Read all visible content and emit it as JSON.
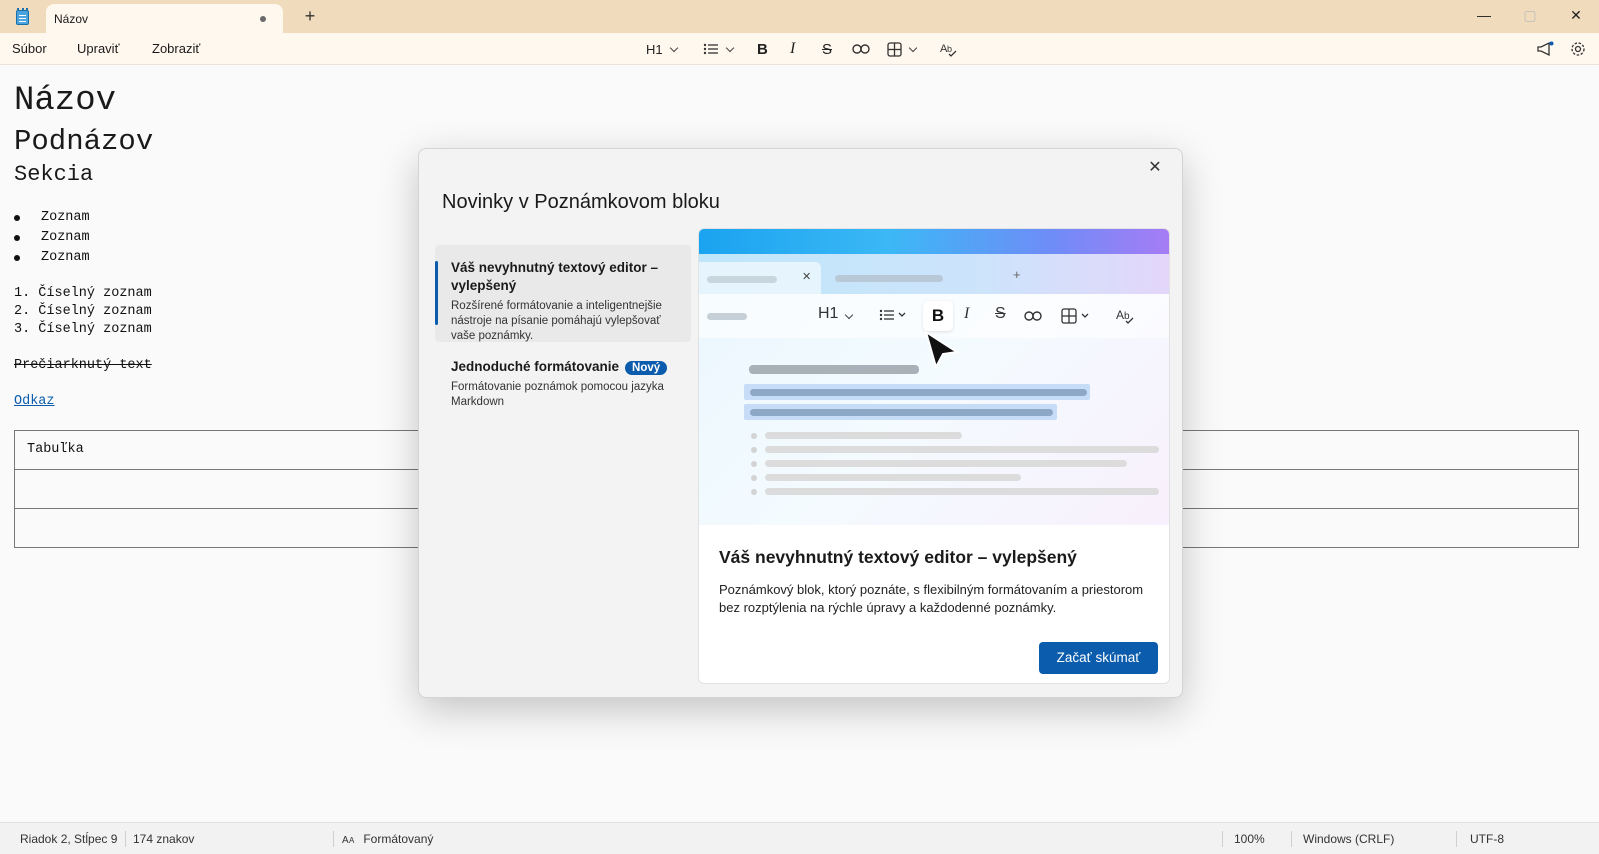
{
  "window": {
    "tab_title": "Názov",
    "new_tab_symbol": "+",
    "minimize_symbol": "—",
    "maximize_symbol": "▢",
    "close_symbol": "✕"
  },
  "menu": {
    "file": "Súbor",
    "edit": "Upraviť",
    "view": "Zobraziť"
  },
  "toolbar": {
    "heading": "H1",
    "bold": "B",
    "italic": "I",
    "strikethrough": "S"
  },
  "document": {
    "title": "Názov",
    "subtitle": "Podnázov",
    "section": "Sekcia",
    "bullets": [
      "Zoznam",
      "Zoznam",
      "Zoznam"
    ],
    "numbered": [
      "1. Číselný zoznam",
      "2. Číselný zoznam",
      "3. Číselný zoznam"
    ],
    "strikethrough_text": "Prečiarknutý text",
    "link_text": "Odkaz",
    "table_header": "Tabuľka"
  },
  "status": {
    "position": "Riadok 2, Stĺpec 9",
    "chars": "174 znakov",
    "mode": "Formátovaný",
    "zoom": "100%",
    "line_endings": "Windows (CRLF)",
    "encoding": "UTF-8"
  },
  "dialog": {
    "title": "Novinky v Poznámkovom bloku",
    "close_symbol": "✕",
    "nav": [
      {
        "heading": "Váš nevyhnutný textový editor – vylepšený",
        "desc": "Rozšírené formátovanie a inteligentnejšie nástroje na písanie pomáhajú vylepšovať vaše poznámky."
      },
      {
        "heading": "Jednoduché formátovanie",
        "badge": "Nový",
        "desc": "Formátovanie poznámok pomocou jazyka Markdown"
      }
    ],
    "hero": {
      "heading": "H1",
      "bold": "B",
      "italic": "I",
      "strike": "S",
      "tab_close": "✕",
      "tab_add": "+"
    },
    "content_title": "Váš nevyhnutný textový editor – vylepšený",
    "content_desc": "Poznámkový blok, ktorý poznáte, s flexibilným formátovaním a priestorom bez rozptýlenia na rýchle úpravy a každodenné poznámky.",
    "cta": "Začať skúmať"
  },
  "colors": {
    "titlebar": "#f0dcbd",
    "menubar": "#fff8ee",
    "accent": "#0b5cad"
  }
}
